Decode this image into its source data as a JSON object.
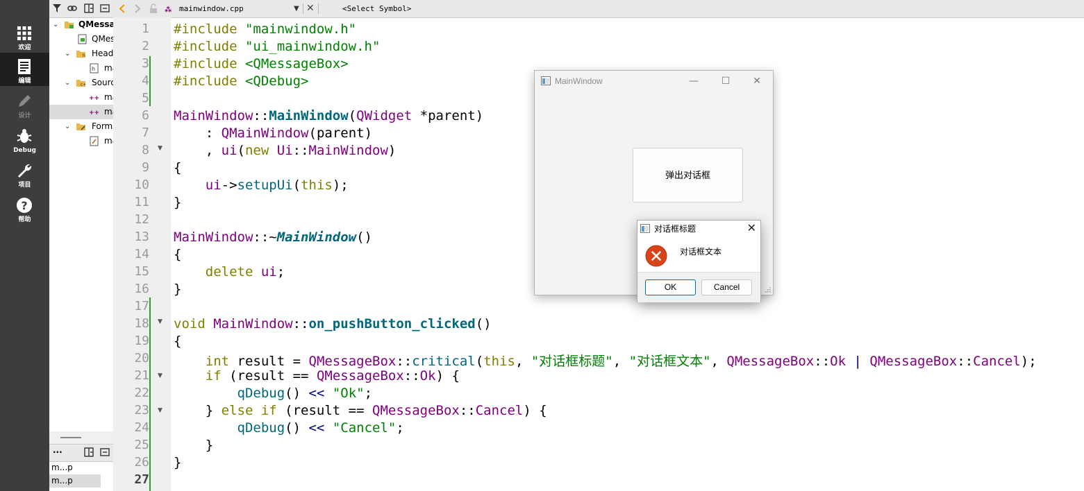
{
  "modebar": {
    "items": [
      {
        "label": "欢迎",
        "icon": "grid-icon"
      },
      {
        "label": "编辑",
        "icon": "document-icon"
      },
      {
        "label": "设计",
        "icon": "pencil-icon"
      },
      {
        "label": "Debug",
        "icon": "bug-icon"
      },
      {
        "label": "项目",
        "icon": "wrench-icon"
      },
      {
        "label": "帮助",
        "icon": "help-icon"
      }
    ]
  },
  "tree": {
    "rows": [
      {
        "label": "QMessa"
      },
      {
        "label": "QMes"
      },
      {
        "label": "Head"
      },
      {
        "label": "ma"
      },
      {
        "label": "Sourc"
      },
      {
        "label": "ma"
      },
      {
        "label": "ma"
      },
      {
        "label": "Form"
      },
      {
        "label": "ma"
      }
    ]
  },
  "open_documents": {
    "menu_label": "···",
    "items": [
      "m...p",
      "m...p"
    ]
  },
  "editor_toolbar": {
    "file_name": "mainwindow.cpp",
    "symbol": "<Select Symbol>"
  },
  "editor": {
    "line_numbers": [
      "1",
      "2",
      "3",
      "4",
      "5",
      "6",
      "7",
      "8",
      "9",
      "10",
      "11",
      "12",
      "13",
      "14",
      "15",
      "16",
      "17",
      "18",
      "19",
      "20",
      "21",
      "22",
      "23",
      "24",
      "25",
      "26",
      "27"
    ],
    "lines": [
      [
        {
          "t": "kw",
          "v": "#include "
        },
        {
          "t": "str",
          "v": "\"mainwindow.h\""
        }
      ],
      [
        {
          "t": "kw",
          "v": "#include "
        },
        {
          "t": "str",
          "v": "\"ui_mainwindow.h\""
        }
      ],
      [
        {
          "t": "kw",
          "v": "#include "
        },
        {
          "t": "str",
          "v": "<QMessageBox>"
        }
      ],
      [
        {
          "t": "kw",
          "v": "#include "
        },
        {
          "t": "str",
          "v": "<QDebug>"
        }
      ],
      [],
      [
        {
          "t": "cls",
          "v": "MainWindow"
        },
        {
          "t": "p",
          "v": "::"
        },
        {
          "t": "fnb",
          "v": "MainWindow"
        },
        {
          "t": "p",
          "v": "("
        },
        {
          "t": "cls",
          "v": "QWidget"
        },
        {
          "t": "p",
          "v": " *"
        },
        {
          "t": "p",
          "v": "parent)"
        }
      ],
      [
        {
          "t": "p",
          "v": "    : "
        },
        {
          "t": "cls",
          "v": "QMainWindow"
        },
        {
          "t": "p",
          "v": "("
        },
        {
          "t": "p",
          "v": "parent)"
        }
      ],
      [
        {
          "t": "p",
          "v": "    , "
        },
        {
          "t": "cls",
          "v": "ui"
        },
        {
          "t": "p",
          "v": "("
        },
        {
          "t": "kw",
          "v": "new "
        },
        {
          "t": "cls",
          "v": "Ui"
        },
        {
          "t": "p",
          "v": "::"
        },
        {
          "t": "cls",
          "v": "MainWindow"
        },
        {
          "t": "p",
          "v": ")"
        }
      ],
      [
        {
          "t": "p",
          "v": "{"
        }
      ],
      [
        {
          "t": "p",
          "v": "    "
        },
        {
          "t": "cls",
          "v": "ui"
        },
        {
          "t": "p",
          "v": "->"
        },
        {
          "t": "fn",
          "v": "setupUi"
        },
        {
          "t": "p",
          "v": "("
        },
        {
          "t": "kw",
          "v": "this"
        },
        {
          "t": "p",
          "v": ");"
        }
      ],
      [
        {
          "t": "p",
          "v": "}"
        }
      ],
      [],
      [
        {
          "t": "cls",
          "v": "MainWindow"
        },
        {
          "t": "p",
          "v": "::~"
        },
        {
          "t": "fni",
          "v": "MainWindow"
        },
        {
          "t": "p",
          "v": "()"
        }
      ],
      [
        {
          "t": "p",
          "v": "{"
        }
      ],
      [
        {
          "t": "p",
          "v": "    "
        },
        {
          "t": "kw",
          "v": "delete "
        },
        {
          "t": "cls",
          "v": "ui"
        },
        {
          "t": "p",
          "v": ";"
        }
      ],
      [
        {
          "t": "p",
          "v": "}"
        }
      ],
      [],
      [
        {
          "t": "kw",
          "v": "void "
        },
        {
          "t": "cls",
          "v": "MainWindow"
        },
        {
          "t": "p",
          "v": "::"
        },
        {
          "t": "fnb",
          "v": "on_pushButton_clicked"
        },
        {
          "t": "p",
          "v": "()"
        }
      ],
      [
        {
          "t": "p",
          "v": "{"
        }
      ],
      [
        {
          "t": "p",
          "v": "    "
        },
        {
          "t": "kw",
          "v": "int "
        },
        {
          "t": "p",
          "v": "result "
        },
        {
          "t": "p",
          "v": "= "
        },
        {
          "t": "cls",
          "v": "QMessageBox"
        },
        {
          "t": "p",
          "v": "::"
        },
        {
          "t": "fn",
          "v": "critical"
        },
        {
          "t": "p",
          "v": "("
        },
        {
          "t": "kw",
          "v": "this"
        },
        {
          "t": "p",
          "v": ", "
        },
        {
          "t": "str",
          "v": "\"对话框标题\""
        },
        {
          "t": "p",
          "v": ", "
        },
        {
          "t": "str",
          "v": "\"对话框文本\""
        },
        {
          "t": "p",
          "v": ", "
        },
        {
          "t": "cls",
          "v": "QMessageBox"
        },
        {
          "t": "p",
          "v": "::"
        },
        {
          "t": "cls",
          "v": "Ok"
        },
        {
          "t": "p",
          "v": " "
        },
        {
          "t": "sym",
          "v": "|"
        },
        {
          "t": "p",
          "v": " "
        },
        {
          "t": "cls",
          "v": "QMessageBox"
        },
        {
          "t": "p",
          "v": "::"
        },
        {
          "t": "cls",
          "v": "Cancel"
        },
        {
          "t": "p",
          "v": ");"
        }
      ],
      [
        {
          "t": "p",
          "v": "    "
        },
        {
          "t": "kw",
          "v": "if "
        },
        {
          "t": "p",
          "v": "(result "
        },
        {
          "t": "p",
          "v": "== "
        },
        {
          "t": "cls",
          "v": "QMessageBox"
        },
        {
          "t": "p",
          "v": "::"
        },
        {
          "t": "cls",
          "v": "Ok"
        },
        {
          "t": "p",
          "v": ") {"
        }
      ],
      [
        {
          "t": "p",
          "v": "        "
        },
        {
          "t": "fn",
          "v": "qDebug"
        },
        {
          "t": "p",
          "v": "() "
        },
        {
          "t": "sym",
          "v": "<<"
        },
        {
          "t": "p",
          "v": " "
        },
        {
          "t": "str",
          "v": "\"Ok\""
        },
        {
          "t": "p",
          "v": ";"
        }
      ],
      [
        {
          "t": "p",
          "v": "    } "
        },
        {
          "t": "kw",
          "v": "else if "
        },
        {
          "t": "p",
          "v": "(result "
        },
        {
          "t": "p",
          "v": "== "
        },
        {
          "t": "cls",
          "v": "QMessageBox"
        },
        {
          "t": "p",
          "v": "::"
        },
        {
          "t": "cls",
          "v": "Cancel"
        },
        {
          "t": "p",
          "v": ") {"
        }
      ],
      [
        {
          "t": "p",
          "v": "        "
        },
        {
          "t": "fn",
          "v": "qDebug"
        },
        {
          "t": "p",
          "v": "() "
        },
        {
          "t": "sym",
          "v": "<<"
        },
        {
          "t": "p",
          "v": " "
        },
        {
          "t": "str",
          "v": "\"Cancel\""
        },
        {
          "t": "p",
          "v": ";"
        }
      ],
      [
        {
          "t": "p",
          "v": "    }"
        }
      ],
      [
        {
          "t": "p",
          "v": "}"
        }
      ],
      []
    ]
  },
  "main_window": {
    "title": "MainWindow",
    "button_label": "弹出对话框"
  },
  "message_box": {
    "title": "对话框标题",
    "text": "对话框文本",
    "ok_label": "OK",
    "cancel_label": "Cancel"
  },
  "colors": {
    "keyword": "#808000",
    "type": "#800080",
    "string": "#008000",
    "function": "#00677c",
    "modebar": "#3d3d3d",
    "critical_icon": "#d8441a"
  }
}
